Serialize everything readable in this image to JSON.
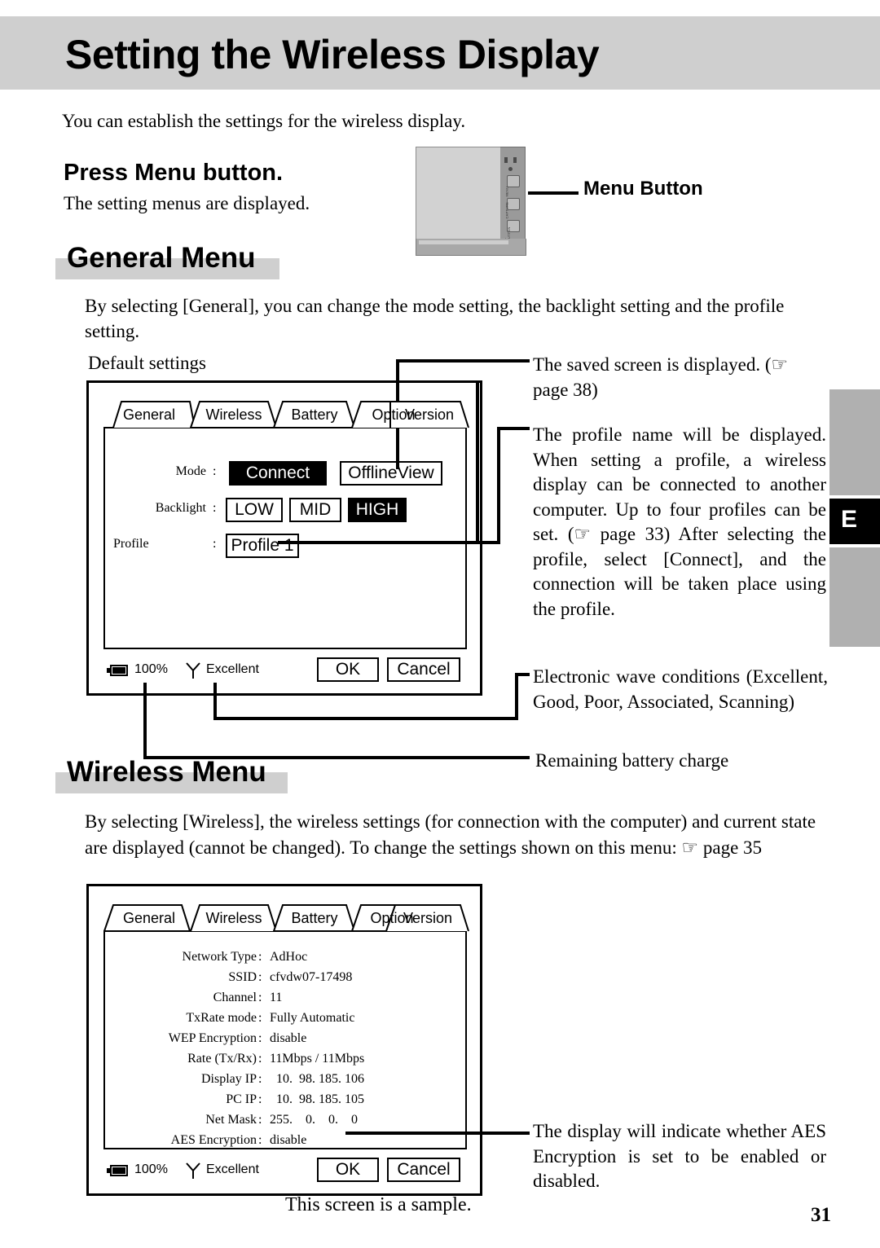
{
  "header": {
    "title": "Setting the Wireless Display"
  },
  "intro": {
    "text": "You can establish the settings for the wireless display."
  },
  "press_menu": {
    "heading": "Press Menu button.",
    "sub": "The setting menus are displayed."
  },
  "device": {
    "callout_label": "Menu Button",
    "button_labels": [
      "MENU",
      "CAPTURE",
      "B-BUTTON"
    ]
  },
  "general_menu": {
    "heading": "General Menu",
    "description": "By selecting [General], you can change the mode setting, the backlight setting and the profile setting.",
    "default_settings_label": "Default settings",
    "tabs": [
      "General",
      "Wireless",
      "Battery",
      "Option",
      "Version"
    ],
    "active_tab": "General",
    "rows": [
      {
        "label": "Mode",
        "colon": ":"
      },
      {
        "label": "Backlight",
        "colon": ":"
      },
      {
        "label": "Profile",
        "colon": ":"
      }
    ],
    "mode_options": [
      {
        "label": "Connect",
        "selected": true
      },
      {
        "label": "OfflineView",
        "selected": false
      }
    ],
    "backlight_options": [
      {
        "label": "LOW",
        "selected": false
      },
      {
        "label": "MID",
        "selected": false
      },
      {
        "label": "HIGH",
        "selected": true
      }
    ],
    "profile_value": "Profile 1",
    "statusbar": {
      "battery_pct": "100%",
      "signal_label": "Excellent",
      "ok": "OK",
      "cancel": "Cancel"
    }
  },
  "wireless_menu": {
    "heading": "Wireless Menu",
    "description": "By selecting [Wireless], the wireless settings (for connection with the computer) and current state are displayed (cannot be changed). To change the settings shown on this menu: ☞ page 35",
    "tabs": [
      "General",
      "Wireless",
      "Battery",
      "Option",
      "Version"
    ],
    "active_tab": "Wireless",
    "rows": [
      {
        "label": "Network Type",
        "colon": ":",
        "value": "AdHoc"
      },
      {
        "label": "SSID",
        "colon": ":",
        "value": "cfvdw07-17498"
      },
      {
        "label": "Channel",
        "colon": ":",
        "value": "11"
      },
      {
        "label": "TxRate mode",
        "colon": ":",
        "value": "Fully Automatic"
      },
      {
        "label": "WEP Encryption",
        "colon": ":",
        "value": "disable"
      },
      {
        "label": "Rate (Tx/Rx)",
        "colon": ":",
        "value": "11Mbps / 11Mbps"
      },
      {
        "label": "Display IP",
        "colon": ":",
        "value": "  10.  98. 185. 106"
      },
      {
        "label": "PC IP",
        "colon": ":",
        "value": "  10.  98. 185. 105"
      },
      {
        "label": "Net Mask",
        "colon": ":",
        "value": "255.    0.    0.    0"
      },
      {
        "label": "AES Encryption",
        "colon": ":",
        "value": "disable"
      }
    ],
    "statusbar": {
      "battery_pct": "100%",
      "signal_label": "Excellent",
      "ok": "OK",
      "cancel": "Cancel"
    },
    "sample_note": "This screen is a sample."
  },
  "callouts": {
    "saved_screen": "The saved screen is displayed. (☞ page 38)",
    "profile_name": "The profile name will be displayed. When setting a profile, a wireless display can be connected to another computer. Up to four profiles can be set. (☞ page 33) After selecting the profile, select [Connect], and the connection will be taken place using the profile.",
    "wave_conditions": "Electronic wave conditions (Excellent, Good, Poor, Associated, Scanning)",
    "battery_charge": "Remaining battery charge",
    "aes_encryption": "The display will indicate whether AES Encryption is set to be enabled or disabled."
  },
  "side_tab": {
    "letter": "E"
  },
  "page_number": "31",
  "colors": {
    "header_band": "#cfcfcf",
    "heading_highlight": "#cfcfcf",
    "side_tab_gray": "#b0b0b0",
    "side_tab_black": "#000000"
  }
}
